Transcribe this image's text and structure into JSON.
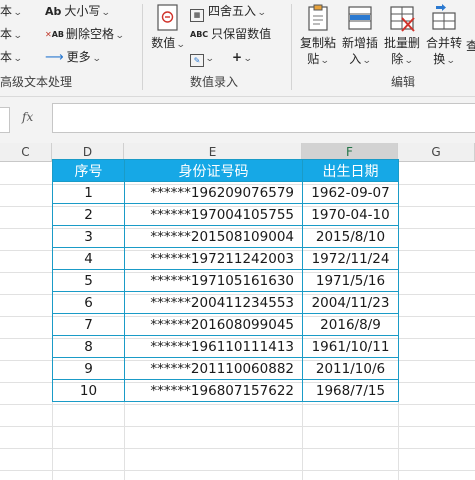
{
  "ribbon": {
    "left_items": {
      "item1": "本",
      "item2": "本",
      "item3": "本"
    },
    "text_group": {
      "case_label": "大小写",
      "delete_spaces_label": "删除空格",
      "more_label": "更多",
      "group_label": "高级文本处理"
    },
    "number_group": {
      "numeric_label": "数值",
      "round_label": "四舍五入",
      "keep_value_label": "只保留数值",
      "group_label": "数值录入"
    },
    "edit_group": {
      "copy_paste_label1": "复制粘",
      "copy_paste_label2": "贴",
      "insert_label1": "新增插",
      "insert_label2": "入",
      "batch_delete_label1": "批量删",
      "batch_delete_label2": "除",
      "merge_label1": "合并转",
      "merge_label2": "换",
      "cut_label": "查",
      "group_label": "编辑"
    }
  },
  "formula_bar": {
    "fx": "fx",
    "value": ""
  },
  "columns": [
    {
      "letter": "C",
      "selected": false
    },
    {
      "letter": "D",
      "selected": false
    },
    {
      "letter": "E",
      "selected": false
    },
    {
      "letter": "F",
      "selected": true
    },
    {
      "letter": "G",
      "selected": false
    }
  ],
  "table": {
    "headers": [
      "序号",
      "身份证号码",
      "出生日期"
    ],
    "rows": [
      [
        "1",
        "******196209076579",
        "1962-09-07"
      ],
      [
        "2",
        "******197004105755",
        "1970-04-10"
      ],
      [
        "3",
        "******201508109004",
        "2015/8/10"
      ],
      [
        "4",
        "******197211242003",
        "1972/11/24"
      ],
      [
        "5",
        "******197105161630",
        "1971/5/16"
      ],
      [
        "6",
        "******200411234553",
        "2004/11/23"
      ],
      [
        "7",
        "******201608099045",
        "2016/8/9"
      ],
      [
        "8",
        "******196110111413",
        "1961/10/11"
      ],
      [
        "9",
        "******201110060882",
        "2011/10/6"
      ],
      [
        "10",
        "******196807157622",
        "1968/7/15"
      ]
    ]
  },
  "colors": {
    "header_fill": "#16a8e6",
    "border": "#1a9bc7",
    "accent": "#217346"
  }
}
